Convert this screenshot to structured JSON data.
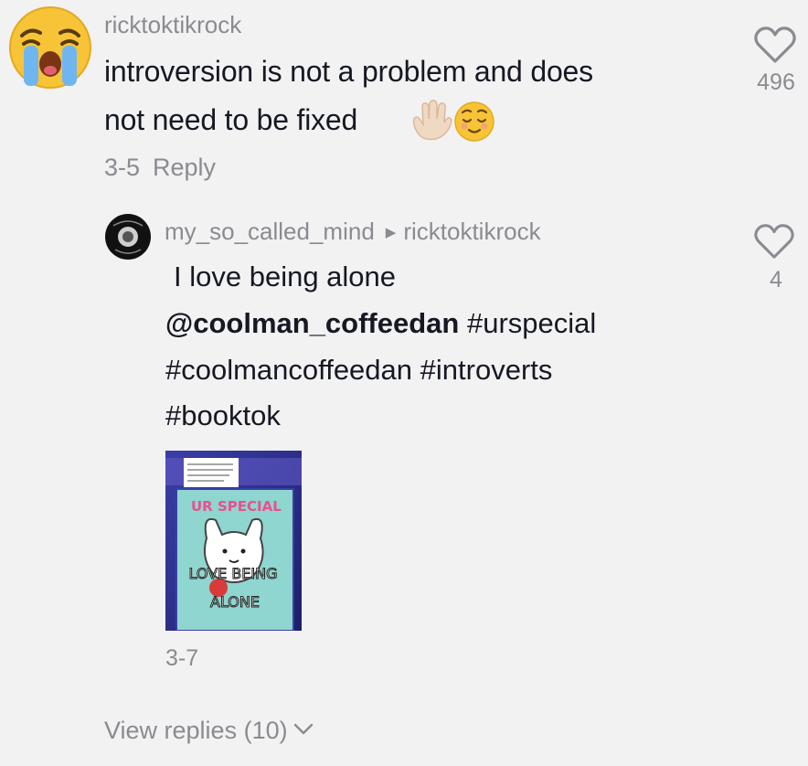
{
  "comment": {
    "username": "ricktoktikrock",
    "text_line1": "introversion is not a problem and does",
    "text_line2": "not need to be fixed",
    "date": "3-5",
    "reply_label": "Reply",
    "likes": "496",
    "avatar_icon": "loudly-crying-face-emoji",
    "emojis": [
      "raised-hand-emoji",
      "relieved-face-emoji"
    ]
  },
  "reply": {
    "username": "my_so_called_mind",
    "reply_to": "ricktoktikrock",
    "text_line1": "I love being alone",
    "mention": "@coolman_coffeedan",
    "tag1": "#urspecial",
    "tag2": "#coolmancoffeedan",
    "tag3": "#introverts",
    "tag4": "#booktok",
    "date": "3-7",
    "likes": "4",
    "image": {
      "title": "UR SPECIAL",
      "caption_line1": "LOVE BEING",
      "caption_line2": "ALONE"
    }
  },
  "footer": {
    "view_replies": "View replies (10)"
  },
  "colors": {
    "background": "#f2f2f3",
    "text": "#161823",
    "secondary": "#8a8b91"
  }
}
